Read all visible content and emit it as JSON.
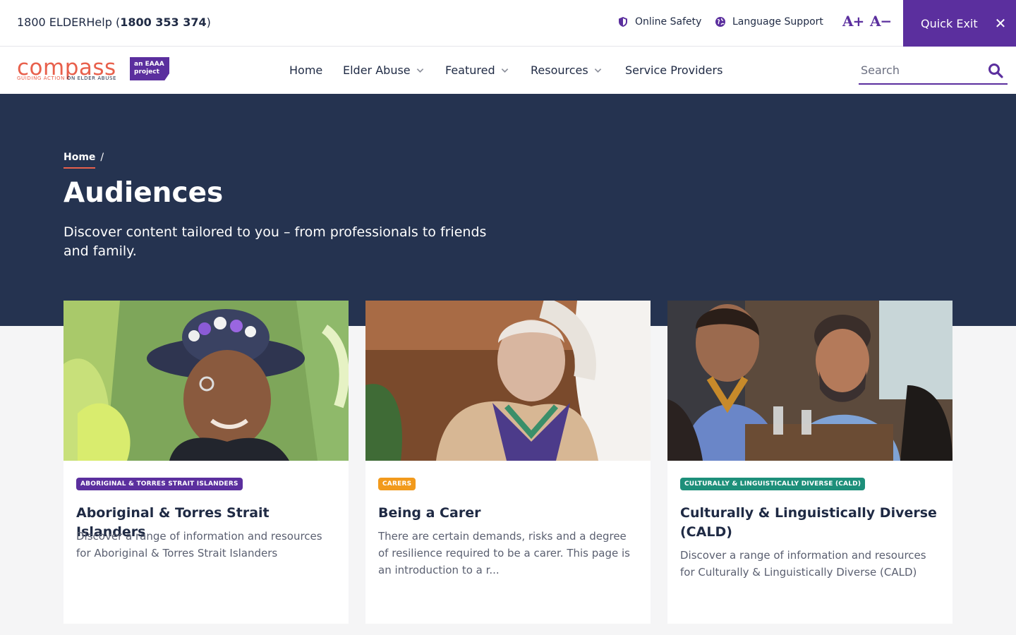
{
  "utility": {
    "helpline_prefix": "1800 ELDERHelp (",
    "helpline_number": "1800 353 374",
    "helpline_suffix": ")",
    "online_safety": "Online Safety",
    "language_support": "Language Support",
    "font_increase": "A+",
    "font_decrease": "A−",
    "quick_exit": "Quick Exit",
    "quick_exit_icon": "✕"
  },
  "logo": {
    "word": "compass",
    "tag_left": "GUIDING ACTION",
    "tag_right": "ON ELDER ABUSE",
    "badge_line1": "an EAAA",
    "badge_line2": "project"
  },
  "nav": {
    "items": [
      {
        "label": "Home",
        "has_dropdown": false
      },
      {
        "label": "Elder Abuse",
        "has_dropdown": true
      },
      {
        "label": "Featured",
        "has_dropdown": true
      },
      {
        "label": "Resources",
        "has_dropdown": true
      },
      {
        "label": "Service Providers",
        "has_dropdown": false
      }
    ],
    "search_placeholder": "Search",
    "search_value": ""
  },
  "hero": {
    "breadcrumb_home": "Home",
    "breadcrumb_sep": "/",
    "title": "Audiences",
    "subtitle": "Discover content tailored to you – from professionals to friends and family."
  },
  "cards": [
    {
      "tag": "ABORIGINAL & TORRES STRAIT ISLANDERS",
      "title": "Aboriginal & Torres Strait Islanders",
      "description": "Discover a range of information and resources for Aboriginal & Torres Strait Islanders"
    },
    {
      "tag": "CARERS",
      "title": "Being a Carer",
      "description": "There are certain demands, risks and a degree of resilience required to be a carer. This page is an introduction to a r..."
    },
    {
      "tag": "CULTURALLY & LINGUISTICALLY DIVERSE (CALD)",
      "title": "Culturally & Linguistically Diverse (CALD)",
      "description": "Discover a range of information and resources for Culturally & Linguistically Diverse (CALD)"
    }
  ],
  "colors": {
    "brand_purple": "#5b2f9e",
    "brand_coral": "#e8604c",
    "hero_navy": "#253350",
    "tag_orange": "#f29a1c",
    "tag_green": "#1d8f7a"
  }
}
